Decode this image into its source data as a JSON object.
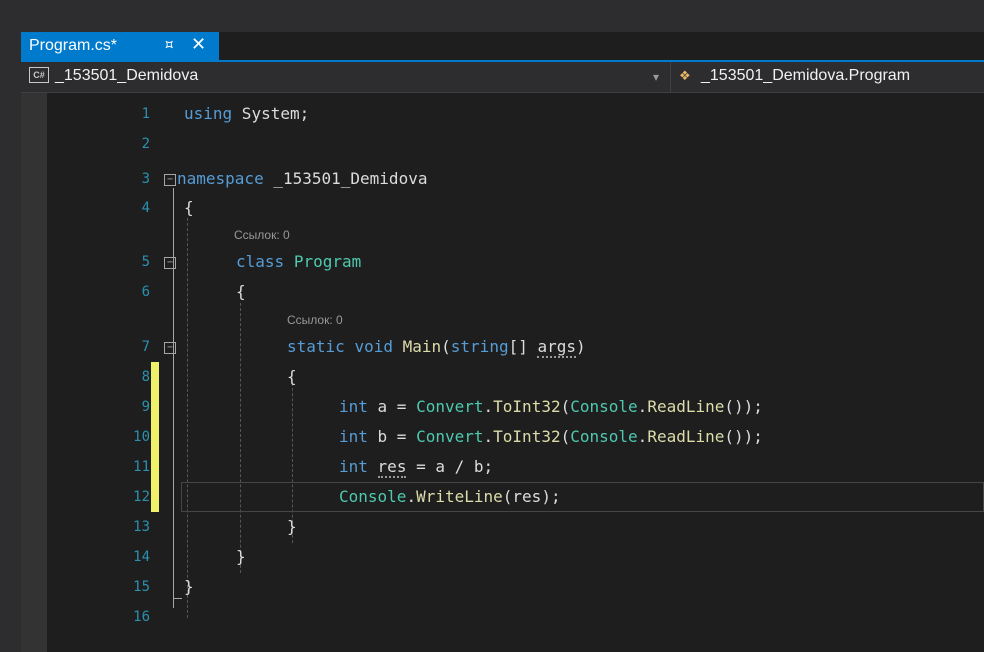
{
  "tab": {
    "title": "Program.cs*",
    "pin_icon": "pin-icon",
    "close_icon": "close-icon"
  },
  "navbar": {
    "project": "_153501_Demidova",
    "member": "_153501_Demidova.Program",
    "lang_badge": "C#"
  },
  "lens": {
    "line5": "Ссылок: 0",
    "line7": "Ссылок: 0"
  },
  "lines": [
    {
      "no": "1"
    },
    {
      "no": "2"
    },
    {
      "no": "3"
    },
    {
      "no": "4"
    },
    {
      "no": "5"
    },
    {
      "no": "6"
    },
    {
      "no": "7"
    },
    {
      "no": "8"
    },
    {
      "no": "9"
    },
    {
      "no": "10"
    },
    {
      "no": "11"
    },
    {
      "no": "12"
    },
    {
      "no": "13"
    },
    {
      "no": "14"
    },
    {
      "no": "15"
    },
    {
      "no": "16"
    }
  ],
  "code": {
    "l1": {
      "kw": "using",
      "rest": " System;"
    },
    "l3": {
      "kw": "namespace",
      "rest": " _153501_Demidova"
    },
    "l4": "{",
    "l5": {
      "kw": "class",
      "type": "Program"
    },
    "l6": "{",
    "l7": {
      "kw1": "static",
      "kw2": "void",
      "method": "Main",
      "open": "(",
      "kw3": "string",
      "rest": "[] ",
      "arg": "args",
      "close": ")"
    },
    "l8": "{",
    "l9": {
      "kw": "int",
      "a": " a = ",
      "type": "Convert",
      "dot1": ".",
      "m1": "ToInt32",
      "p1": "(",
      "type2": "Console",
      "dot2": ".",
      "m2": "ReadLine",
      "end": "());"
    },
    "l10": {
      "kw": "int",
      "a": " b = ",
      "type": "Convert",
      "dot1": ".",
      "m1": "ToInt32",
      "p1": "(",
      "type2": "Console",
      "dot2": ".",
      "m2": "ReadLine",
      "end": "());"
    },
    "l11": {
      "kw": "int",
      "sp": " ",
      "var": "res",
      "rest": " = a / b;"
    },
    "l12": {
      "type": "Console",
      "dot": ".",
      "method": "WriteLine",
      "rest": "(res);"
    },
    "l13": "}",
    "l14": "}",
    "l15": "}"
  },
  "colors": {
    "keyword": "#569cd6",
    "type": "#4ec9b0",
    "method": "#dcdcaa",
    "line_number": "#2b91af",
    "accent": "#007acc",
    "change_bar": "#eff16a"
  }
}
